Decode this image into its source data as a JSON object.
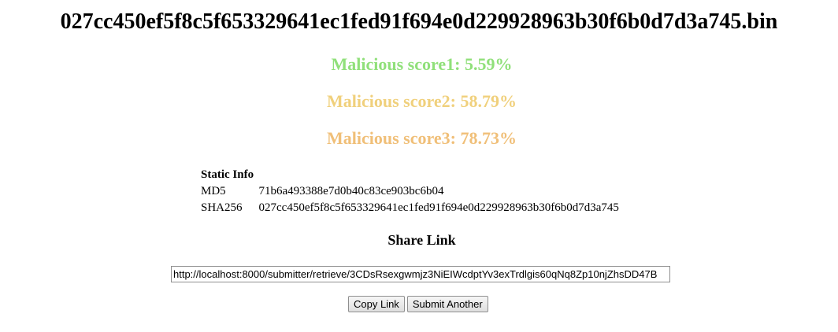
{
  "file": {
    "title": "027cc450ef5f8c5f653329641ec1fed91f694e0d229928963b30f6b0d7d3a745.bin"
  },
  "scores": [
    {
      "text": "Malicious score1: 5.59%",
      "color": "#90e07a"
    },
    {
      "text": "Malicious score2: 58.79%",
      "color": "#f0d07c"
    },
    {
      "text": "Malicious score3: 78.73%",
      "color": "#f0bf78"
    }
  ],
  "static_info": {
    "heading": "Static Info",
    "rows": [
      {
        "label": "MD5",
        "value": "71b6a493388e7d0b40c83ce903bc6b04"
      },
      {
        "label": "SHA256",
        "value": "027cc450ef5f8c5f653329641ec1fed91f694e0d229928963b30f6b0d7d3a745"
      }
    ]
  },
  "share": {
    "heading": "Share Link",
    "url": "http://localhost:8000/submitter/retrieve/3CDsRsexgwmjz3NiEIWcdptYv3exTrdlgis60qNq8Zp10njZhsDD47B"
  },
  "buttons": {
    "copy_label": "Copy Link",
    "submit_label": "Submit Another"
  }
}
